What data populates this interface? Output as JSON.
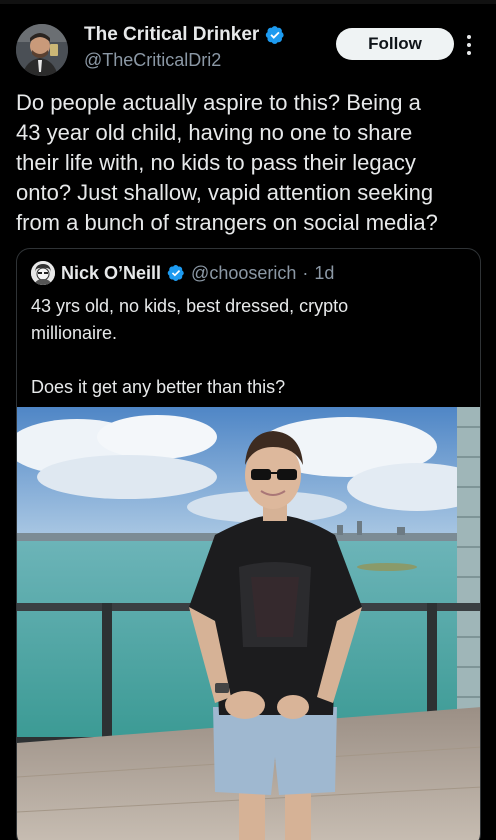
{
  "tweet": {
    "author": {
      "display_name": "The Critical Drinker",
      "handle": "@TheCriticalDri2",
      "verified_icon": "verified-badge-icon",
      "avatar_icon": "avatar-man-with-glass"
    },
    "follow_label": "Follow",
    "more_icon": "more-options-icon",
    "text_lines": [
      "Do people actually aspire to this? Being a",
      "43 year old child, having no one to share",
      "their life with, no kids to pass their legacy",
      "onto? Just shallow, vapid attention seeking",
      "from a bunch of strangers on social media?"
    ]
  },
  "quoted_tweet": {
    "author": {
      "display_name": "Nick O’Neill",
      "handle": "@chooserich",
      "time": "1d",
      "separator": "·",
      "verified_icon": "verified-badge-icon",
      "avatar_icon": "avatar-cartoon"
    },
    "text_lines": [
      "43 yrs old, no kids, best dressed, crypto",
      "millionaire.",
      "",
      "Does it get any better than this?"
    ],
    "media": {
      "icon": "photo-man-on-balcony",
      "description_colors": {
        "sky": "#6fa3d8",
        "water": "#4fa9a5",
        "shirt": "#1c1c1e",
        "shorts": "#9fb8d0"
      }
    }
  },
  "colors": {
    "background": "#000000",
    "text": "#e7e9ea",
    "secondary_text": "#8b98a5",
    "verified_blue": "#1d9bf0",
    "border": "#2f3336",
    "follow_bg": "#eff3f4"
  }
}
